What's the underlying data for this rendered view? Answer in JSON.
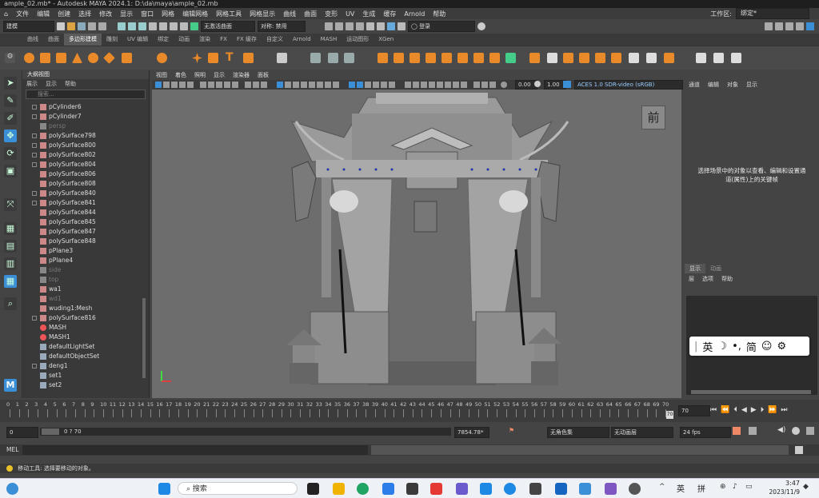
{
  "title": "ample_02.mb* - Autodesk MAYA 2024.1: D:\\da\\maya\\ample_02.mb",
  "menu": [
    "文件",
    "编辑",
    "创建",
    "选择",
    "修改",
    "显示",
    "窗口",
    "网格",
    "编辑网格",
    "网格工具",
    "网格显示",
    "曲线",
    "曲面",
    "变形",
    "UV",
    "生成",
    "缓存",
    "Arnold",
    "帮助"
  ],
  "workspace_label": "工作区:",
  "workspace_value": "绑定*",
  "mode_dropdown": "建模",
  "live_surface": "无激活曲面",
  "symmetry": "对称: 禁用",
  "login": "登录",
  "shelf_tabs": [
    "曲线",
    "曲面",
    "多边形建模",
    "雕刻",
    "UV 编辑",
    "绑定",
    "动画",
    "渲染",
    "FX",
    "FX 缓存",
    "自定义",
    "Arnold",
    "MASH",
    "运动图形",
    "XGen"
  ],
  "shelf_active": "多边形建模",
  "outliner": {
    "title": "大纲视图",
    "menu": [
      "展示",
      "显示",
      "帮助"
    ],
    "search_placeholder": "搜索...",
    "items": [
      {
        "name": "pCylinder6",
        "type": "mesh",
        "exp": true,
        "dim": false
      },
      {
        "name": "pCylinder7",
        "type": "mesh",
        "exp": true,
        "dim": false
      },
      {
        "name": "persp",
        "type": "cam",
        "exp": false,
        "dim": true
      },
      {
        "name": "polySurface798",
        "type": "mesh",
        "exp": true,
        "dim": false
      },
      {
        "name": "polySurface800",
        "type": "mesh",
        "exp": true,
        "dim": false
      },
      {
        "name": "polySurface802",
        "type": "mesh",
        "exp": true,
        "dim": false
      },
      {
        "name": "polySurface804",
        "type": "mesh",
        "exp": true,
        "dim": false
      },
      {
        "name": "polySurface806",
        "type": "mesh",
        "exp": false,
        "dim": false
      },
      {
        "name": "polySurface808",
        "type": "mesh",
        "exp": false,
        "dim": false
      },
      {
        "name": "polySurface840",
        "type": "mesh",
        "exp": true,
        "dim": false
      },
      {
        "name": "polySurface841",
        "type": "mesh",
        "exp": true,
        "dim": false
      },
      {
        "name": "polySurface844",
        "type": "mesh",
        "exp": false,
        "dim": false
      },
      {
        "name": "polySurface845",
        "type": "mesh",
        "exp": false,
        "dim": false
      },
      {
        "name": "polySurface847",
        "type": "mesh",
        "exp": false,
        "dim": false
      },
      {
        "name": "polySurface848",
        "type": "mesh",
        "exp": false,
        "dim": false
      },
      {
        "name": "pPlane3",
        "type": "mesh",
        "exp": false,
        "dim": false
      },
      {
        "name": "pPlane4",
        "type": "mesh",
        "exp": false,
        "dim": false
      },
      {
        "name": "side",
        "type": "cam",
        "exp": false,
        "dim": true
      },
      {
        "name": "top",
        "type": "cam",
        "exp": false,
        "dim": true
      },
      {
        "name": "wa1",
        "type": "mesh",
        "exp": false,
        "dim": false
      },
      {
        "name": "wd1",
        "type": "mesh",
        "exp": false,
        "dim": true
      },
      {
        "name": "wuding1:Mesh",
        "type": "mesh",
        "exp": false,
        "dim": false
      },
      {
        "name": "polySurface816",
        "type": "mesh",
        "exp": true,
        "dim": false
      },
      {
        "name": "MASH",
        "type": "mash",
        "exp": false,
        "dim": false
      },
      {
        "name": "MASH1",
        "type": "mash",
        "exp": false,
        "dim": false
      },
      {
        "name": "defaultLightSet",
        "type": "set",
        "exp": false,
        "dim": false
      },
      {
        "name": "defaultObjectSet",
        "type": "set",
        "exp": false,
        "dim": false
      },
      {
        "name": "deng1",
        "type": "group",
        "exp": true,
        "dim": false
      },
      {
        "name": "set1",
        "type": "set",
        "exp": false,
        "dim": false
      },
      {
        "name": "set2",
        "type": "set",
        "exp": false,
        "dim": false
      }
    ]
  },
  "viewport": {
    "menu": [
      "视图",
      "着色",
      "照明",
      "显示",
      "渲染器",
      "面板"
    ],
    "exposure": "0.00",
    "gamma": "1.00",
    "colorspace": "ACES 1.0 SDR-video (sRGB)",
    "view_label": "前"
  },
  "channelbox": {
    "menu": [
      "通道",
      "编辑",
      "对象",
      "显示"
    ],
    "hint": "选择场景中的对象以查看、编辑和设置通道(属性)上的关键帧",
    "layer_tabs": [
      "显示",
      "动画"
    ],
    "layer_menu": [
      "层",
      "选项",
      "帮助"
    ]
  },
  "timeline": {
    "ticks": [
      "0",
      "1",
      "2",
      "3",
      "4",
      "5",
      "6",
      "7",
      "8",
      "9",
      "10",
      "11",
      "12",
      "13",
      "14",
      "15",
      "16",
      "17",
      "18",
      "19",
      "20",
      "21",
      "22",
      "23",
      "24",
      "25",
      "26",
      "27",
      "28",
      "29",
      "30",
      "31",
      "32",
      "33",
      "34",
      "35",
      "36",
      "37",
      "38",
      "39",
      "40",
      "41",
      "42",
      "43",
      "44",
      "45",
      "46",
      "47",
      "48",
      "49",
      "50",
      "51",
      "52",
      "53",
      "54",
      "55",
      "56",
      "57",
      "58",
      "59",
      "60",
      "61",
      "62",
      "63",
      "64",
      "65",
      "66",
      "67",
      "68",
      "69",
      "70"
    ],
    "current_frame": "70",
    "current_frame_below": "70"
  },
  "range": {
    "start": "0",
    "range_text": "0 ? 70",
    "end": "7854.78*",
    "character_set": "无角色集",
    "anim_layer": "无动画层",
    "fps": "24 fps"
  },
  "mel_label": "MEL",
  "help_text": "移动工具: 选择要移动的对象。",
  "ime": {
    "lang": "英",
    "simp": "简"
  },
  "taskbar": {
    "search_placeholder": "搜索",
    "tray_lang1": "英",
    "tray_lang2": "拼",
    "time": "3:47",
    "date": "2023/11/9"
  }
}
